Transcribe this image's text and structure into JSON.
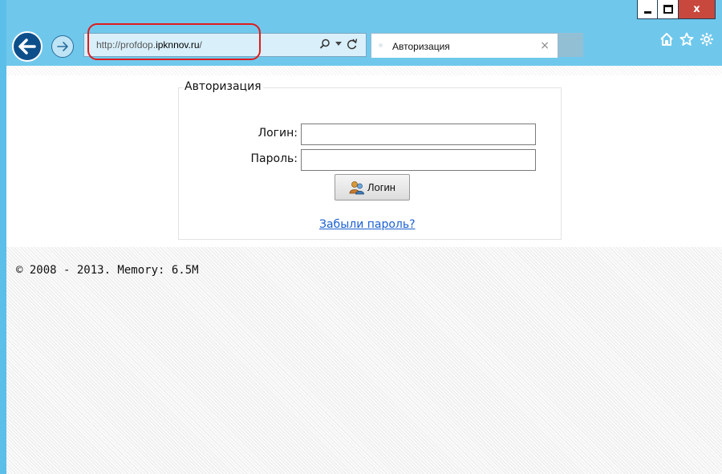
{
  "browser": {
    "address": {
      "url_prefix": "http://profdop.",
      "url_host": "ipknnov.ru",
      "url_suffix": "/"
    },
    "tab": {
      "title": "Авторизация",
      "close_glyph": "×"
    },
    "window_controls": {
      "close_glyph": "x"
    },
    "icons": [
      "back-arrow-icon",
      "forward-arrow-icon",
      "search-icon",
      "dropdown-icon",
      "refresh-icon",
      "home-icon",
      "favorites-star-icon",
      "settings-gear-icon"
    ]
  },
  "login": {
    "legend": "Авторизация",
    "login_label": "Логин:",
    "password_label": "Пароль:",
    "login_value": "",
    "password_value": "",
    "submit_label": "Логин",
    "forgot_link": "Забыли пароль?"
  },
  "footer": {
    "text": "© 2008 - 2013. Memory: 6.5M"
  },
  "colors": {
    "chrome": "#6fc8ec",
    "highlight": "#e01b1b",
    "link": "#1a5fd1"
  }
}
